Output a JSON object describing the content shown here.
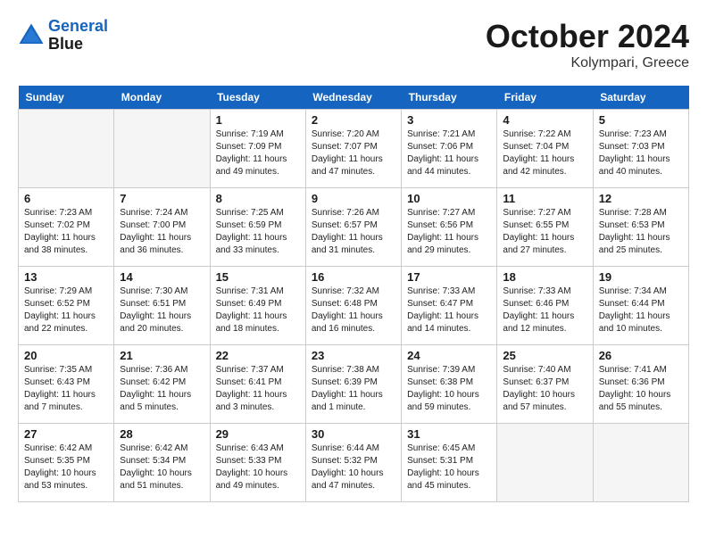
{
  "header": {
    "logo_line1": "General",
    "logo_line2": "Blue",
    "month": "October 2024",
    "location": "Kolympari, Greece"
  },
  "weekdays": [
    "Sunday",
    "Monday",
    "Tuesday",
    "Wednesday",
    "Thursday",
    "Friday",
    "Saturday"
  ],
  "weeks": [
    [
      {
        "day": "",
        "info": ""
      },
      {
        "day": "",
        "info": ""
      },
      {
        "day": "1",
        "info": "Sunrise: 7:19 AM\nSunset: 7:09 PM\nDaylight: 11 hours and 49 minutes."
      },
      {
        "day": "2",
        "info": "Sunrise: 7:20 AM\nSunset: 7:07 PM\nDaylight: 11 hours and 47 minutes."
      },
      {
        "day": "3",
        "info": "Sunrise: 7:21 AM\nSunset: 7:06 PM\nDaylight: 11 hours and 44 minutes."
      },
      {
        "day": "4",
        "info": "Sunrise: 7:22 AM\nSunset: 7:04 PM\nDaylight: 11 hours and 42 minutes."
      },
      {
        "day": "5",
        "info": "Sunrise: 7:23 AM\nSunset: 7:03 PM\nDaylight: 11 hours and 40 minutes."
      }
    ],
    [
      {
        "day": "6",
        "info": "Sunrise: 7:23 AM\nSunset: 7:02 PM\nDaylight: 11 hours and 38 minutes."
      },
      {
        "day": "7",
        "info": "Sunrise: 7:24 AM\nSunset: 7:00 PM\nDaylight: 11 hours and 36 minutes."
      },
      {
        "day": "8",
        "info": "Sunrise: 7:25 AM\nSunset: 6:59 PM\nDaylight: 11 hours and 33 minutes."
      },
      {
        "day": "9",
        "info": "Sunrise: 7:26 AM\nSunset: 6:57 PM\nDaylight: 11 hours and 31 minutes."
      },
      {
        "day": "10",
        "info": "Sunrise: 7:27 AM\nSunset: 6:56 PM\nDaylight: 11 hours and 29 minutes."
      },
      {
        "day": "11",
        "info": "Sunrise: 7:27 AM\nSunset: 6:55 PM\nDaylight: 11 hours and 27 minutes."
      },
      {
        "day": "12",
        "info": "Sunrise: 7:28 AM\nSunset: 6:53 PM\nDaylight: 11 hours and 25 minutes."
      }
    ],
    [
      {
        "day": "13",
        "info": "Sunrise: 7:29 AM\nSunset: 6:52 PM\nDaylight: 11 hours and 22 minutes."
      },
      {
        "day": "14",
        "info": "Sunrise: 7:30 AM\nSunset: 6:51 PM\nDaylight: 11 hours and 20 minutes."
      },
      {
        "day": "15",
        "info": "Sunrise: 7:31 AM\nSunset: 6:49 PM\nDaylight: 11 hours and 18 minutes."
      },
      {
        "day": "16",
        "info": "Sunrise: 7:32 AM\nSunset: 6:48 PM\nDaylight: 11 hours and 16 minutes."
      },
      {
        "day": "17",
        "info": "Sunrise: 7:33 AM\nSunset: 6:47 PM\nDaylight: 11 hours and 14 minutes."
      },
      {
        "day": "18",
        "info": "Sunrise: 7:33 AM\nSunset: 6:46 PM\nDaylight: 11 hours and 12 minutes."
      },
      {
        "day": "19",
        "info": "Sunrise: 7:34 AM\nSunset: 6:44 PM\nDaylight: 11 hours and 10 minutes."
      }
    ],
    [
      {
        "day": "20",
        "info": "Sunrise: 7:35 AM\nSunset: 6:43 PM\nDaylight: 11 hours and 7 minutes."
      },
      {
        "day": "21",
        "info": "Sunrise: 7:36 AM\nSunset: 6:42 PM\nDaylight: 11 hours and 5 minutes."
      },
      {
        "day": "22",
        "info": "Sunrise: 7:37 AM\nSunset: 6:41 PM\nDaylight: 11 hours and 3 minutes."
      },
      {
        "day": "23",
        "info": "Sunrise: 7:38 AM\nSunset: 6:39 PM\nDaylight: 11 hours and 1 minute."
      },
      {
        "day": "24",
        "info": "Sunrise: 7:39 AM\nSunset: 6:38 PM\nDaylight: 10 hours and 59 minutes."
      },
      {
        "day": "25",
        "info": "Sunrise: 7:40 AM\nSunset: 6:37 PM\nDaylight: 10 hours and 57 minutes."
      },
      {
        "day": "26",
        "info": "Sunrise: 7:41 AM\nSunset: 6:36 PM\nDaylight: 10 hours and 55 minutes."
      }
    ],
    [
      {
        "day": "27",
        "info": "Sunrise: 6:42 AM\nSunset: 5:35 PM\nDaylight: 10 hours and 53 minutes."
      },
      {
        "day": "28",
        "info": "Sunrise: 6:42 AM\nSunset: 5:34 PM\nDaylight: 10 hours and 51 minutes."
      },
      {
        "day": "29",
        "info": "Sunrise: 6:43 AM\nSunset: 5:33 PM\nDaylight: 10 hours and 49 minutes."
      },
      {
        "day": "30",
        "info": "Sunrise: 6:44 AM\nSunset: 5:32 PM\nDaylight: 10 hours and 47 minutes."
      },
      {
        "day": "31",
        "info": "Sunrise: 6:45 AM\nSunset: 5:31 PM\nDaylight: 10 hours and 45 minutes."
      },
      {
        "day": "",
        "info": ""
      },
      {
        "day": "",
        "info": ""
      }
    ]
  ]
}
